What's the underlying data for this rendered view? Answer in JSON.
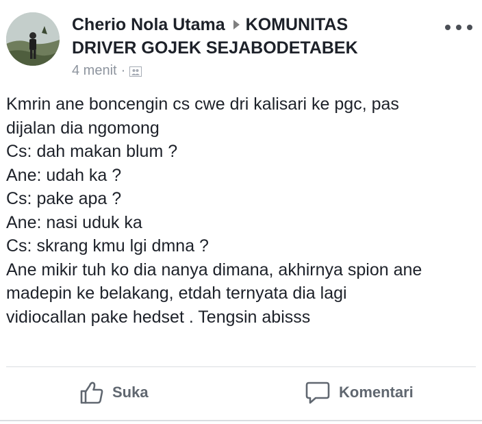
{
  "post": {
    "author": "Cherio Nola Utama",
    "group_line1": "KOMUNITAS",
    "group_line2": "DRIVER GOJEK SEJABODETABEK",
    "time": "4 menit",
    "separator": "·",
    "privacy_icon": "group-icon",
    "text_lines": [
      "Kmrin ane boncengin cs cwe dri kalisari ke pgc, pas",
      "dijalan dia ngomong",
      "Cs: dah makan blum ?",
      "Ane: udah ka ?",
      "Cs: pake apa ?",
      "Ane: nasi uduk ka",
      "Cs: skrang kmu lgi dmna ?",
      "Ane mikir tuh ko dia nanya dimana, akhirnya spion ane",
      "madepin ke belakang, etdah ternyata dia lagi",
      "vidiocallan pake hedset . Tengsin abisss"
    ]
  },
  "actions": {
    "like_label": "Suka",
    "comment_label": "Komentari"
  },
  "icons": {
    "more": "more-icon",
    "like": "thumbs-up-icon",
    "comment": "comment-icon"
  },
  "colors": {
    "text": "#1d2129",
    "meta": "#8d949e",
    "action": "#606770",
    "divider": "#dadde1"
  }
}
